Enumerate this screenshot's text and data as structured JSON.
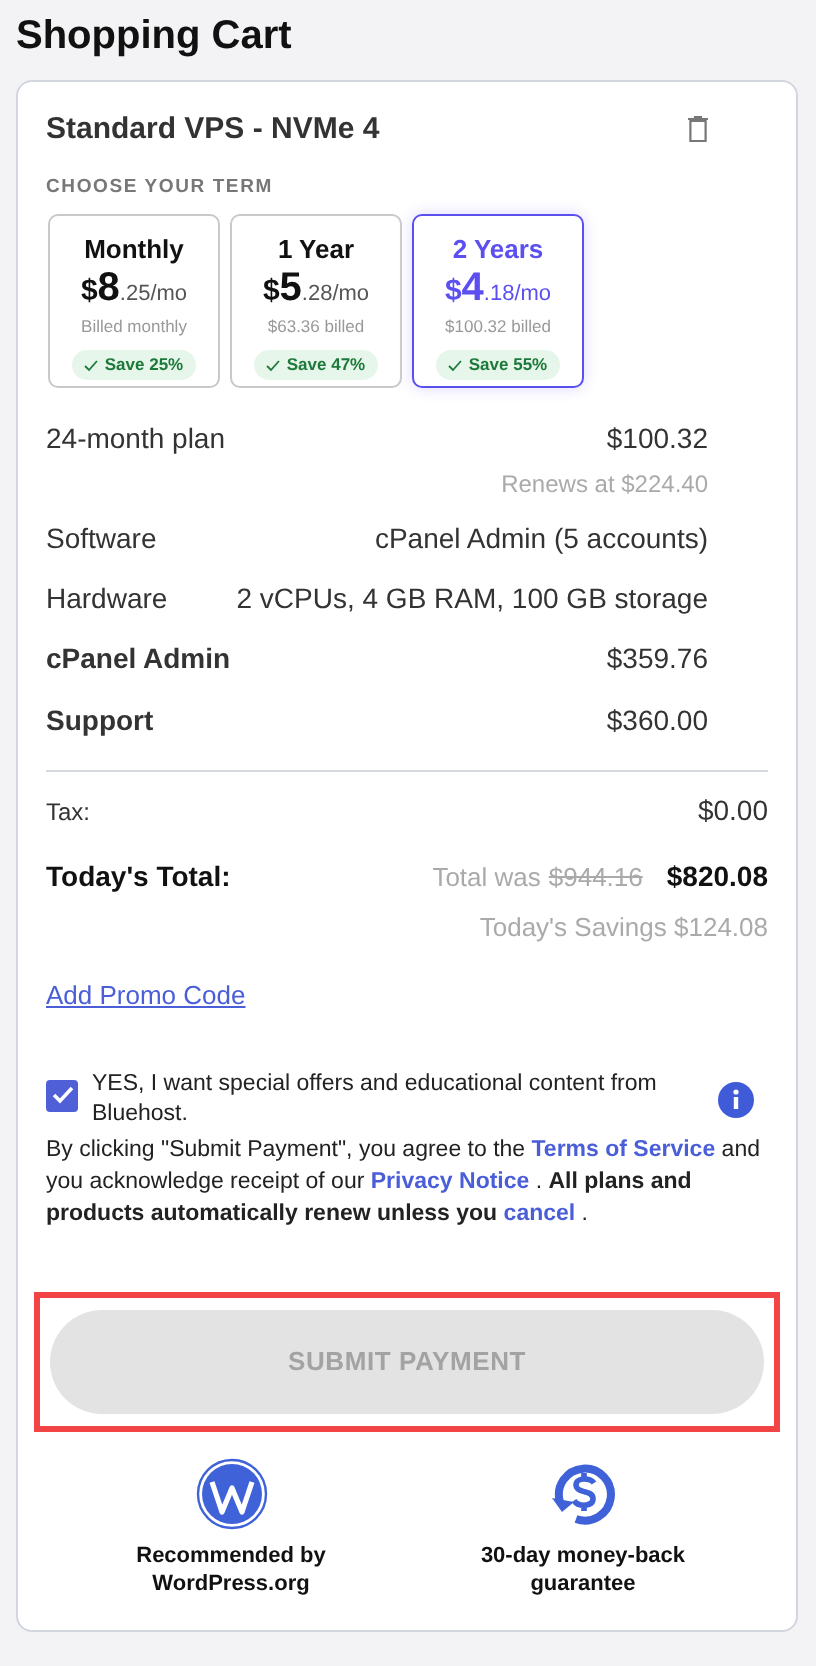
{
  "page_title": "Shopping Cart",
  "product": {
    "name": "Standard VPS - NVMe 4",
    "term_heading": "CHOOSE YOUR TERM",
    "terms": [
      {
        "label": "Monthly",
        "symbol": "$",
        "whole": "8",
        "fraction": ".25/mo",
        "billed": "Billed monthly",
        "save": "Save 25%",
        "selected": false
      },
      {
        "label": "1 Year",
        "symbol": "$",
        "whole": "5",
        "fraction": ".28/mo",
        "billed": "$63.36 billed",
        "save": "Save 47%",
        "selected": false
      },
      {
        "label": "2 Years",
        "symbol": "$",
        "whole": "4",
        "fraction": ".18/mo",
        "billed": "$100.32 billed",
        "save": "Save 55%",
        "selected": true
      }
    ],
    "lines": [
      {
        "kind": "plan",
        "label": "24-month plan",
        "value": "$100.32",
        "note": "Renews at $224.40"
      },
      {
        "kind": "detail",
        "label": "Software",
        "value": "cPanel Admin (5 accounts)"
      },
      {
        "kind": "detail",
        "label": "Hardware",
        "value": "2 vCPUs, 4 GB RAM, 100 GB storage"
      },
      {
        "kind": "addon",
        "label": "cPanel Admin",
        "value": "$359.76"
      },
      {
        "kind": "addon",
        "label": "Support",
        "value": "$360.00"
      }
    ]
  },
  "tax": {
    "label": "Tax:",
    "value": "$0.00"
  },
  "total": {
    "label": "Today's Total:",
    "was_label": "Total was",
    "was_amount": "$944.16",
    "value": "$820.08",
    "savings": "Today's Savings $124.08"
  },
  "promo_link": "Add Promo Code",
  "offers": {
    "checked": true,
    "text": "YES, I want special offers and educational content from Bluehost."
  },
  "terms_text": [
    {
      "kind": "text",
      "text": " By clicking \"Submit Payment\", you agree to the "
    },
    {
      "kind": "link",
      "text": "Terms of Service"
    },
    {
      "kind": "text",
      "text": " and you acknowledge receipt of our "
    },
    {
      "kind": "link",
      "text": "Privacy Notice"
    },
    {
      "kind": "text",
      "text": " .  "
    },
    {
      "kind": "bold",
      "text": "All plans and products automatically renew unless you "
    },
    {
      "kind": "link",
      "text": "cancel"
    },
    {
      "kind": "text",
      "text": " ."
    }
  ],
  "submit": {
    "label": "SUBMIT PAYMENT",
    "disabled": true,
    "highlighted": true
  },
  "badges": [
    {
      "kind": "wordpress",
      "text": "Recommended by WordPress.org"
    },
    {
      "kind": "money",
      "text": "30-day money-back guarantee"
    }
  ]
}
